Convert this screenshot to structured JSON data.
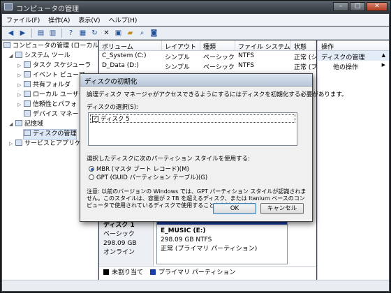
{
  "window": {
    "title": "コンピュータの管理",
    "controls": {
      "minimize": "–",
      "maximize": "□",
      "close": "✕"
    }
  },
  "menu": [
    "ファイル(F)",
    "操作(A)",
    "表示(V)",
    "ヘルプ(H)"
  ],
  "toolbar_icons": [
    "back-icon",
    "forward-icon",
    "up-icon",
    "show-hide-tree-icon",
    "help-icon",
    "properties-icon",
    "refresh-icon",
    "delete-icon",
    "new-icon",
    "open-folder-icon",
    "search-icon",
    "zoom-icon"
  ],
  "tree": [
    {
      "label": "コンピュータの管理 (ローカル)",
      "level": 0,
      "icon": "computer-icon"
    },
    {
      "label": "システム ツール",
      "level": 1,
      "icon": "tools-icon"
    },
    {
      "label": "タスク スケジューラ",
      "level": 2,
      "icon": "clock-icon"
    },
    {
      "label": "イベント ビューア",
      "level": 2,
      "icon": "event-icon"
    },
    {
      "label": "共有フォルダ",
      "level": 2,
      "icon": "folder-icon"
    },
    {
      "label": "ローカル ユーザー",
      "level": 2,
      "icon": "users-icon"
    },
    {
      "label": "信頼性とパフォ",
      "level": 2,
      "icon": "performance-icon"
    },
    {
      "label": "デバイス マネー",
      "level": 2,
      "icon": "device-icon"
    },
    {
      "label": "記憶域",
      "level": 1,
      "icon": "storage-icon"
    },
    {
      "label": "ディスクの管理",
      "level": 2,
      "icon": "disk-icon",
      "selected": true
    },
    {
      "label": "サービスとアプリケ",
      "level": 1,
      "icon": "services-icon"
    }
  ],
  "columns": [
    "ボリューム",
    "レイアウト",
    "種類",
    "ファイル システム",
    "状態"
  ],
  "volumes": [
    [
      "C_System (C:)",
      "シンプル",
      "ベーシック",
      "NTFS",
      "正常 (シ"
    ],
    [
      "D_Data (D:)",
      "シンプル",
      "ベーシック",
      "NTFS",
      "正常 (プ"
    ]
  ],
  "operations": {
    "header": "操作",
    "section": "ディスクの管理",
    "more": "他の操作"
  },
  "diskmap": {
    "disk_name": "ディスク 1",
    "disk_type": "ベーシック",
    "disk_size": "298.09 GB",
    "disk_status": "オンライン",
    "vol_name": "E_MUSIC (E:)",
    "vol_size": "298.09 GB NTFS",
    "vol_status": "正常 (プライマリ パーティション)"
  },
  "legend": {
    "unallocated": "未割り当て",
    "primary": "プライマリ パーティション"
  },
  "dialog": {
    "title": "ディスクの初期化",
    "intro": "論理ディスク マネージャがアクセスできるようにするにはディスクを初期化する必要があります。",
    "select_label": "ディスクの選択(S):",
    "disk_item": "ディスク 5",
    "disk_checked": true,
    "style_label": "選択したディスクに次のパーティション スタイルを使用する:",
    "mbr": "MBR (マスタ ブート レコード)(M)",
    "gpt": "GPT (GUID パーティション テーブル)(G)",
    "selected_style": "MBR",
    "note": "注意: 以前のバージョンの Windows では、GPT パーティション スタイルが認識されません。このスタイルは、容量が 2 TB を超えるディスク、または Itanium ベースのコンピュータで使用されているディスクで使用することをお勧めします。",
    "ok": "OK",
    "cancel": "キャンセル"
  },
  "colors": {
    "primary_partition": "#1b3ea8",
    "unallocated": "#000000"
  }
}
